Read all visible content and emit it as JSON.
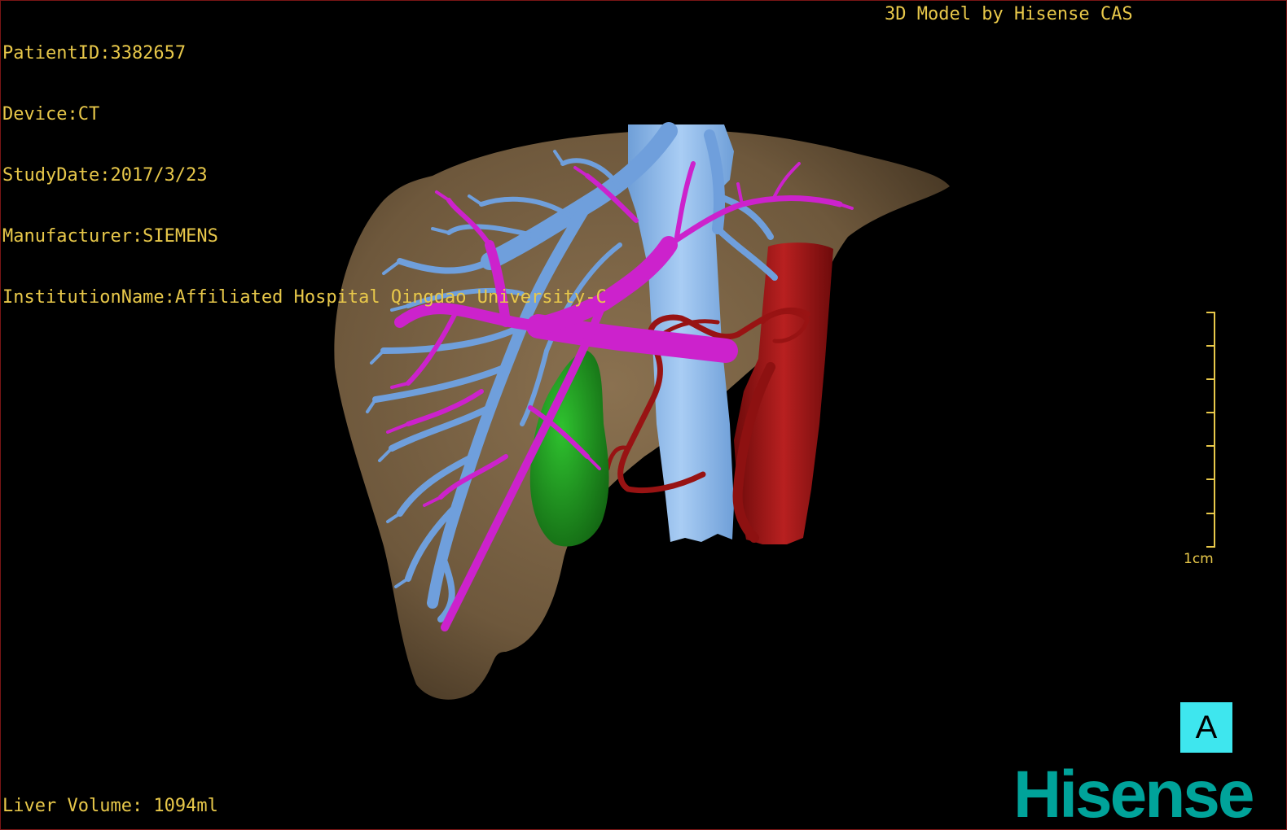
{
  "patient_info": {
    "patient_id": "PatientID:3382657",
    "device": "Device:CT",
    "study_date": "StudyDate:2017/3/23",
    "manufacturer": "Manufacturer:SIEMENS",
    "institution": "InstitutionName:Affiliated Hospital Qingdao University-C"
  },
  "model_credit": "3D Model by Hisense CAS",
  "liver_volume": "Liver Volume: 1094ml",
  "scale_bar": {
    "label": "1cm"
  },
  "view_label": "A",
  "brand": "Hisense",
  "colors": {
    "overlay_text": "#e8c84a",
    "liver": "#7a6244",
    "portal_vein": "#cc22cc",
    "hepatic_vein": "#6f9fdc",
    "ivc": "#8cbcf0",
    "aorta": "#9b1414",
    "gallbladder": "#1f9c1f",
    "view_label_bg": "#3ee6ee",
    "brand": "#00a39a"
  }
}
